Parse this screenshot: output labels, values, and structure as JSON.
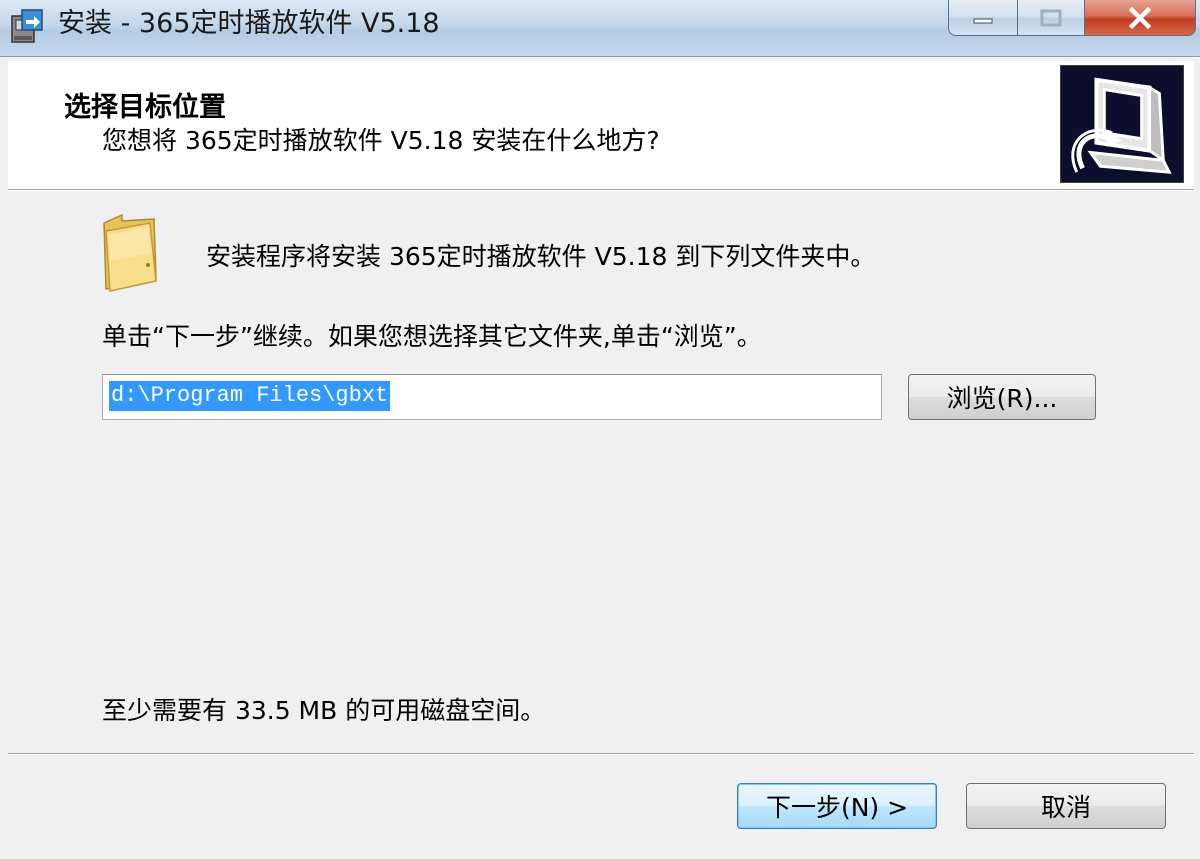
{
  "window": {
    "title": "安装 - 365定时播放软件 V5.18"
  },
  "header": {
    "title": "选择目标位置",
    "subtitle": "您想将 365定时播放软件 V5.18 安装在什么地方?"
  },
  "content": {
    "info": "安装程序将安装 365定时播放软件 V5.18 到下列文件夹中。",
    "instruction": "单击“下一步”继续。如果您想选择其它文件夹,单击“浏览”。",
    "path_value": "d:\\Program Files\\gbxt",
    "browse_label": "浏览(R)...",
    "disk_space": "至少需要有 33.5 MB 的可用磁盘空间。"
  },
  "footer": {
    "next_label": "下一步(N) >",
    "cancel_label": "取消"
  },
  "icons": {
    "app": "installer-icon",
    "folder": "folder-icon",
    "wizard": "computer-install-image",
    "minimize": "minimize-icon",
    "maximize": "maximize-icon",
    "close": "close-icon"
  },
  "colors": {
    "selection": "#3399ff",
    "close_button": "#c9452a",
    "wizard_image_bg": "#0d0d2e"
  }
}
